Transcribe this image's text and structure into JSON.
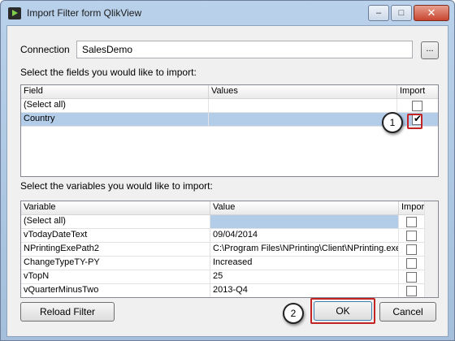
{
  "window": {
    "title": "Import Filter form QlikView",
    "minimize_label": "–",
    "maximize_label": "□",
    "close_label": "✕"
  },
  "connection": {
    "label": "Connection",
    "value": "SalesDemo",
    "browse_label": "..."
  },
  "fields": {
    "prompt": "Select the fields you would like to import:",
    "columns": [
      "Field",
      "Values",
      "Import"
    ],
    "rows": [
      {
        "field": "(Select all)",
        "values": "",
        "import": false
      },
      {
        "field": "Country",
        "values": "",
        "import": true
      }
    ]
  },
  "variables": {
    "prompt": "Select the variables you would like to import:",
    "columns": [
      "Variable",
      "Value",
      "Import"
    ],
    "rows": [
      {
        "variable": "(Select all)",
        "value": "",
        "import": false
      },
      {
        "variable": "vTodayDateText",
        "value": "09/04/2014",
        "import": false
      },
      {
        "variable": "NPrintingExePath2",
        "value": "C:\\Program Files\\NPrinting\\Client\\NPrinting.exe",
        "import": false
      },
      {
        "variable": "ChangeTypeTY-PY",
        "value": "Increased",
        "import": false
      },
      {
        "variable": "vTopN",
        "value": "25",
        "import": false
      },
      {
        "variable": "vQuarterMinusTwo",
        "value": "2013-Q4",
        "import": false
      }
    ]
  },
  "footer": {
    "reload_label": "Reload Filter",
    "ok_label": "OK",
    "cancel_label": "Cancel"
  },
  "callouts": [
    "1",
    "2"
  ],
  "colors": {
    "highlight": "#b3cce8",
    "annotation_red": "#c42323"
  }
}
